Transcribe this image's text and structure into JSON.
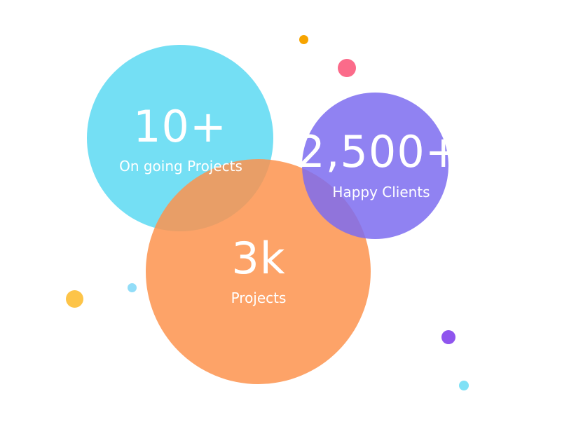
{
  "stats": {
    "ongoing": {
      "value": "10+",
      "label": "On going Projects",
      "color": "#5CD9F2"
    },
    "projects": {
      "value": "3k",
      "label": "Projects",
      "color": "#FD934E"
    },
    "clients": {
      "value": "2,500+",
      "label": "Happy Clients",
      "color": "#7C6CF0"
    }
  },
  "decorations": {
    "colors": [
      "#F7A400",
      "#FB6B8A",
      "#FDC448",
      "#92DDF8",
      "#8F55EE",
      "#80E1F6"
    ]
  }
}
